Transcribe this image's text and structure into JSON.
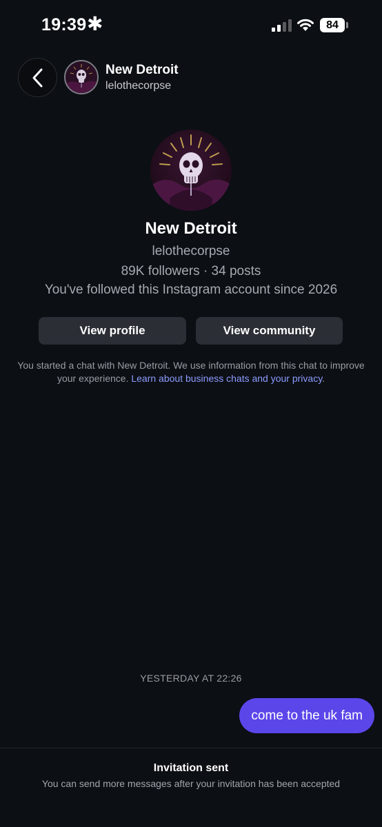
{
  "status_bar": {
    "time": "19:39",
    "asterisk": "✱",
    "battery": "84"
  },
  "header": {
    "title": "New Detroit",
    "username": "lelothecorpse",
    "back_icon": "chevron-left-icon"
  },
  "profile": {
    "name": "New Detroit",
    "username": "lelothecorpse",
    "stats": "89K followers · 34 posts",
    "follow_since": "You've followed this Instagram account since 2026",
    "view_profile_label": "View profile",
    "view_community_label": "View community"
  },
  "disclaimer": {
    "text": "You started a chat with New Detroit. We use information from this chat to improve your experience. ",
    "link_text": "Learn about business chats and your privacy",
    "suffix": "."
  },
  "conversation": {
    "timestamp": "YESTERDAY AT 22:26",
    "messages": [
      {
        "text": "come to the uk fam"
      }
    ]
  },
  "footer": {
    "title": "Invitation sent",
    "subtitle": "You can send more messages after your invitation has been accepted"
  },
  "colors": {
    "background": "#0c0f14",
    "bubble": "#5b46ea",
    "link": "#8d9cff",
    "button": "#2b2e35"
  }
}
